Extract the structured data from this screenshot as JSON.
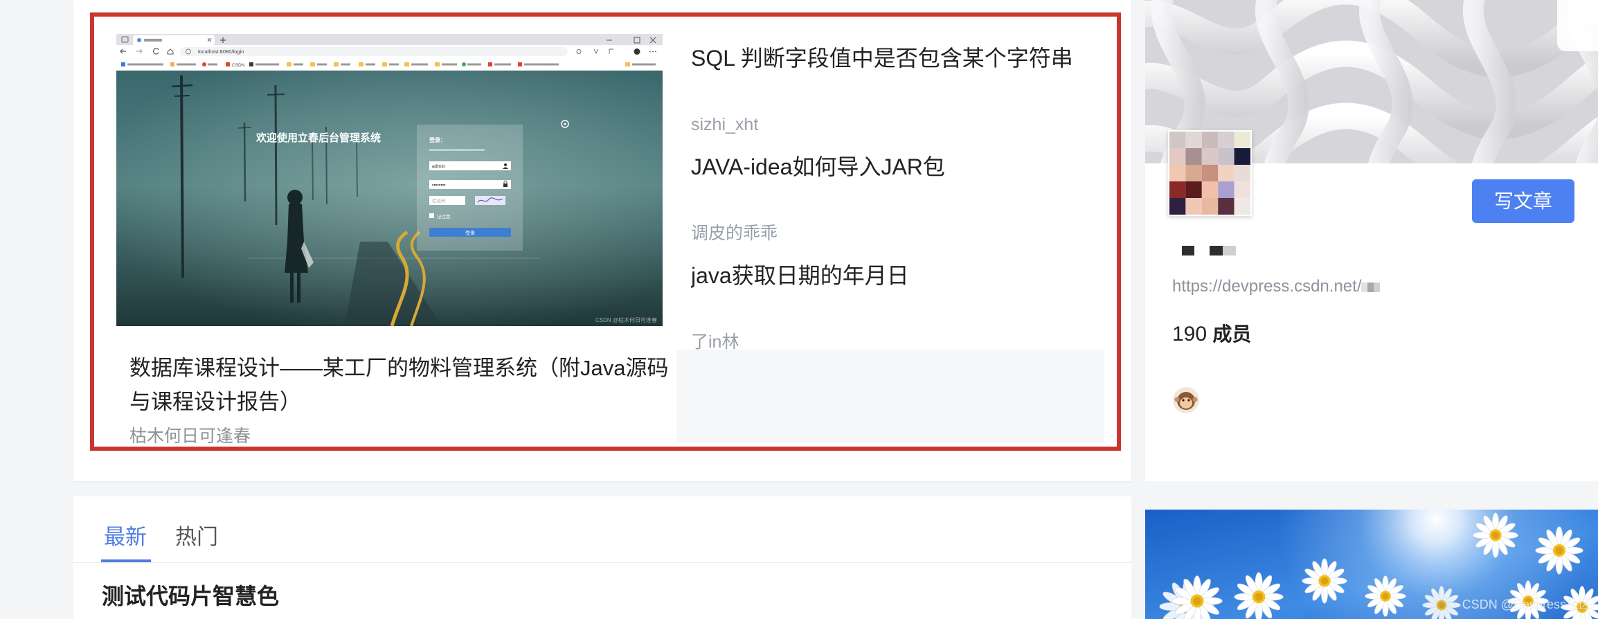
{
  "colors": {
    "accent_blue": "#4d80f1",
    "highlight_red": "#c8372d",
    "tab_active": "#4f7de0"
  },
  "featured": {
    "title": "数据库课程设计——某工厂的物料管理系统（附Java源码与课程设计报告）",
    "author": "枯木何日可逢春",
    "thumbnail": {
      "url": "localhost:8080/login",
      "bookmark_csdn": "CSDN",
      "welcome": "欢迎使用立春后台管理系统",
      "login_title": "登录：",
      "username": "admin",
      "password": "••••••••",
      "captcha_placeholder": "验证码",
      "remember_me": "记住我",
      "login_button": "登录",
      "watermark": "CSDN @枯木何日可逢春"
    }
  },
  "related": [
    {
      "title": "SQL 判断字段值中是否包含某个字符串",
      "author": "sizhi_xht"
    },
    {
      "title": "JAVA-idea如何导入JAR包",
      "author": "调皮的乖乖"
    },
    {
      "title": "java获取日期的年月日",
      "author": "了in林"
    }
  ],
  "feed": {
    "tabs": [
      {
        "label": "最新",
        "active": true
      },
      {
        "label": "热门",
        "active": false
      }
    ],
    "first_post_title": "测试代码片智慧色"
  },
  "community": {
    "write_button": "写文章",
    "url": "https://devpress.csdn.net/",
    "member_count": "190",
    "member_label": "成员"
  },
  "page_watermark": "CSDN @Devpress社区"
}
